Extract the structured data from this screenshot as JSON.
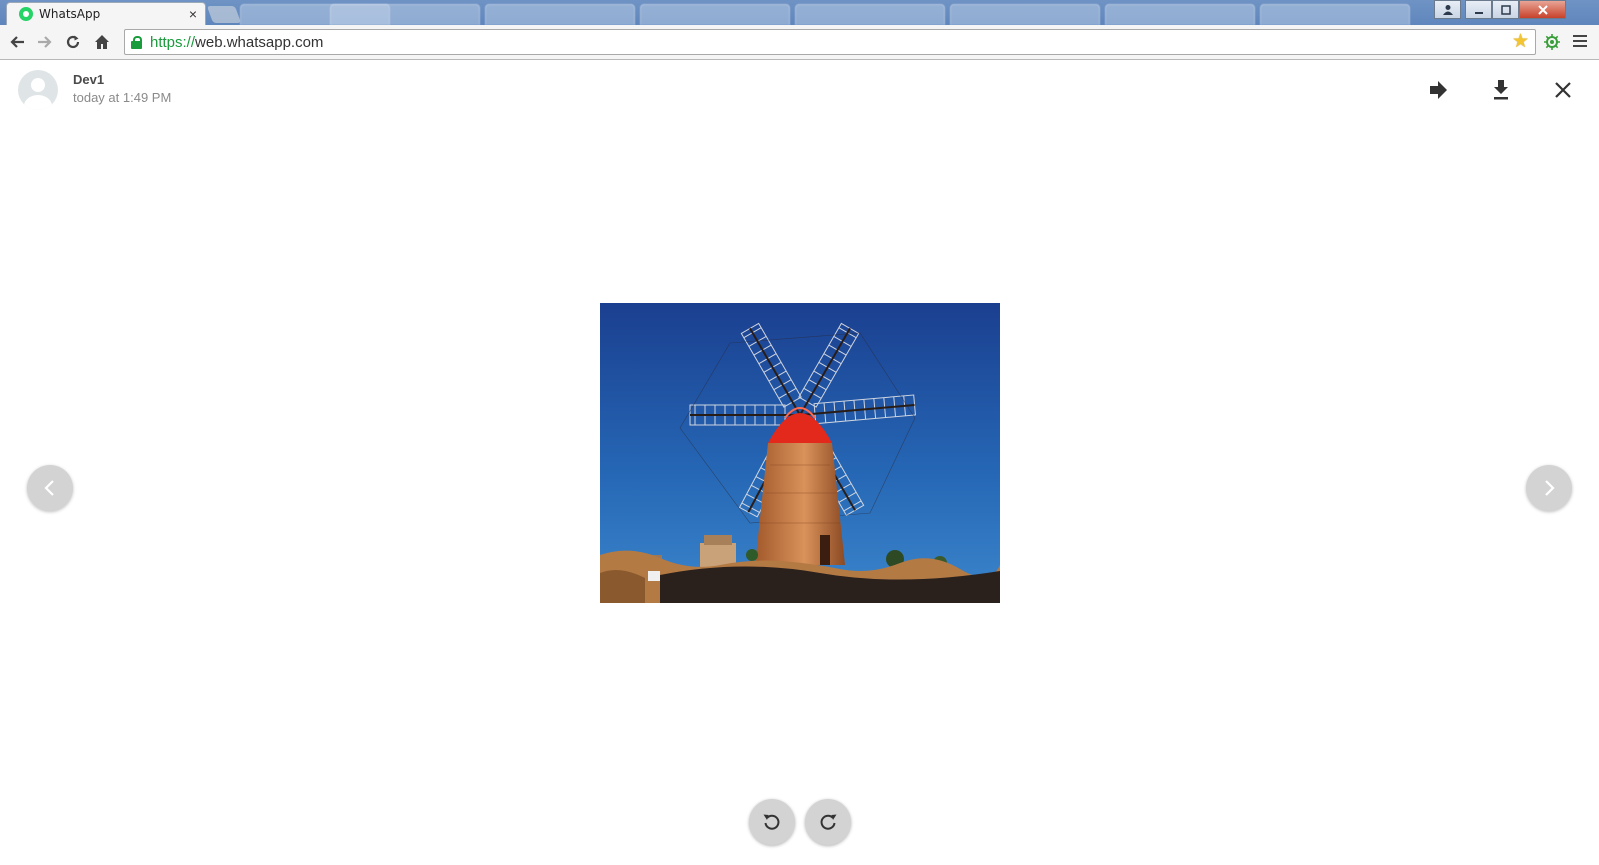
{
  "browser": {
    "active_tab": {
      "title": "WhatsApp",
      "favicon": "whatsapp-icon",
      "close_label": "×"
    },
    "address_bar": {
      "scheme": "https://",
      "host": "web.whatsapp.com"
    },
    "icons": {
      "back": "back-arrow-icon",
      "forward": "forward-arrow-icon",
      "reload": "reload-icon",
      "home": "home-icon",
      "bookmark": "star-icon",
      "extension": "extension-icon",
      "menu": "hamburger-menu-icon"
    },
    "colors": {
      "secure": "#1a9b3c",
      "star": "#f2c531"
    }
  },
  "viewer": {
    "sender_name": "Dev1",
    "timestamp": "today at 1:49 PM",
    "actions": [
      "forward-icon",
      "download-icon",
      "close-icon"
    ],
    "image_subject": "windmill",
    "nav": [
      "previous-icon",
      "next-icon"
    ],
    "rotate": [
      "rotate-left-icon",
      "rotate-right-icon"
    ]
  }
}
